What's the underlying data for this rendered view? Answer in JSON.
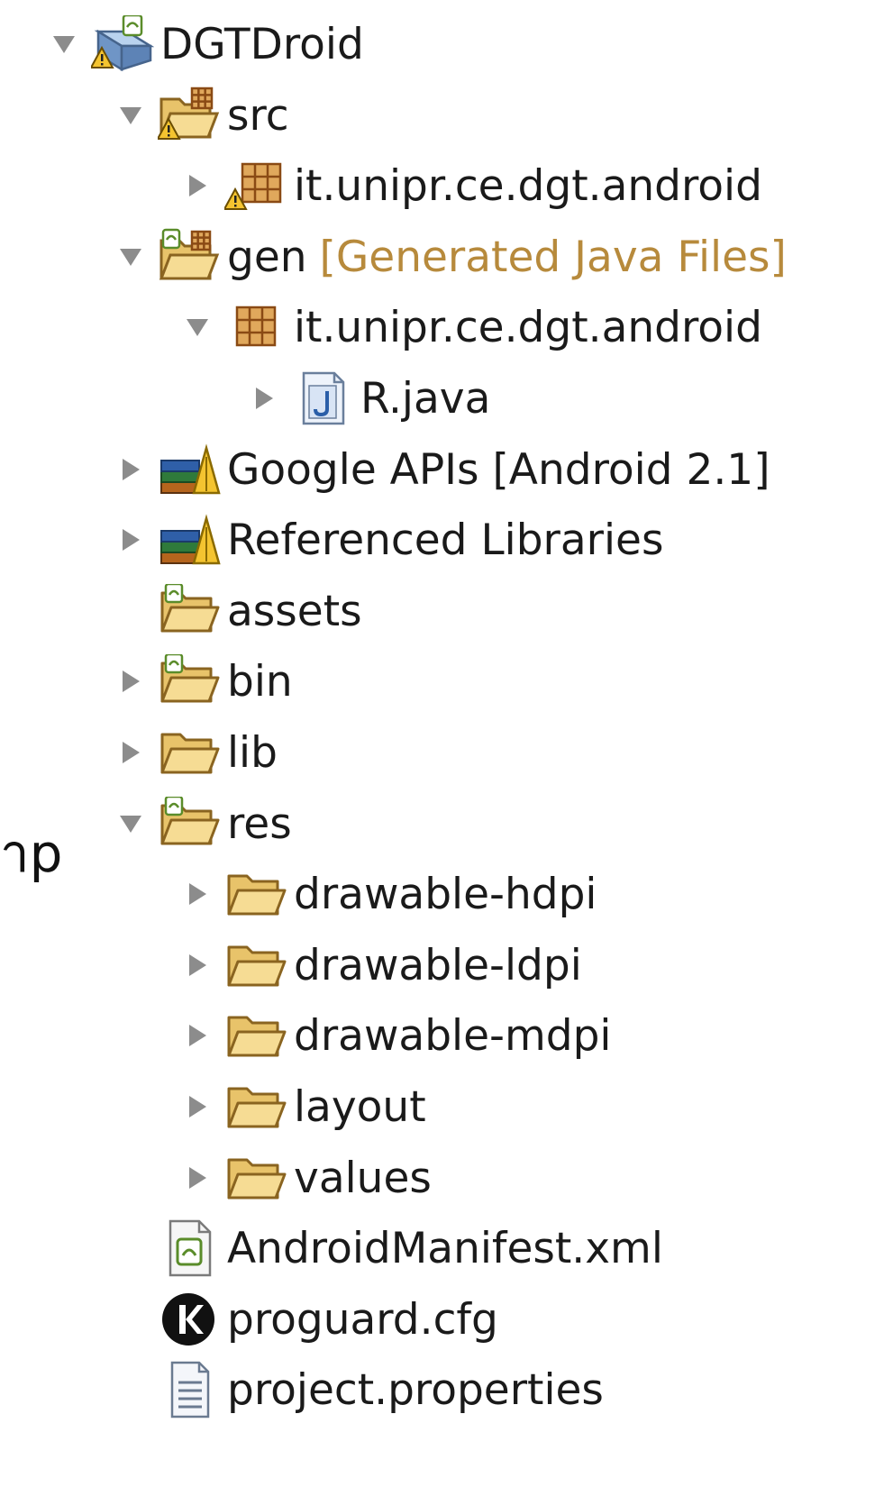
{
  "edge_fragment": "าp",
  "tree": [
    {
      "label": "DGTDroid",
      "icon": "android-project-warning-icon",
      "state": "expanded",
      "decoration": ""
    },
    {
      "label": "src",
      "icon": "source-folder-warning-icon",
      "state": "expanded",
      "decoration": ""
    },
    {
      "label": "it.unipr.ce.dgt.android",
      "icon": "package-warning-icon",
      "state": "collapsed",
      "decoration": ""
    },
    {
      "label": "gen",
      "icon": "generated-source-folder-icon",
      "state": "expanded",
      "decoration": "[Generated Java Files]"
    },
    {
      "label": "it.unipr.ce.dgt.android",
      "icon": "package-icon",
      "state": "expanded",
      "decoration": ""
    },
    {
      "label": "R.java",
      "icon": "java-file-icon",
      "state": "collapsed",
      "decoration": ""
    },
    {
      "label": "Google APIs [Android 2.1]",
      "icon": "library-container-icon",
      "state": "collapsed",
      "decoration": ""
    },
    {
      "label": "Referenced Libraries",
      "icon": "library-container-icon",
      "state": "collapsed",
      "decoration": ""
    },
    {
      "label": "assets",
      "icon": "android-folder-icon",
      "state": "leaf",
      "decoration": ""
    },
    {
      "label": "bin",
      "icon": "android-folder-icon",
      "state": "collapsed",
      "decoration": ""
    },
    {
      "label": "lib",
      "icon": "folder-icon",
      "state": "collapsed",
      "decoration": ""
    },
    {
      "label": "res",
      "icon": "android-folder-icon",
      "state": "expanded",
      "decoration": ""
    },
    {
      "label": "drawable-hdpi",
      "icon": "folder-icon",
      "state": "collapsed",
      "decoration": ""
    },
    {
      "label": "drawable-ldpi",
      "icon": "folder-icon",
      "state": "collapsed",
      "decoration": ""
    },
    {
      "label": "drawable-mdpi",
      "icon": "folder-icon",
      "state": "collapsed",
      "decoration": ""
    },
    {
      "label": "layout",
      "icon": "folder-icon",
      "state": "collapsed",
      "decoration": ""
    },
    {
      "label": "values",
      "icon": "folder-icon",
      "state": "collapsed",
      "decoration": ""
    },
    {
      "label": "AndroidManifest.xml",
      "icon": "android-manifest-file-icon",
      "state": "leaf",
      "decoration": ""
    },
    {
      "label": "proguard.cfg",
      "icon": "proguard-file-icon",
      "state": "leaf",
      "decoration": ""
    },
    {
      "label": "project.properties",
      "icon": "text-file-icon",
      "state": "leaf",
      "decoration": ""
    }
  ]
}
